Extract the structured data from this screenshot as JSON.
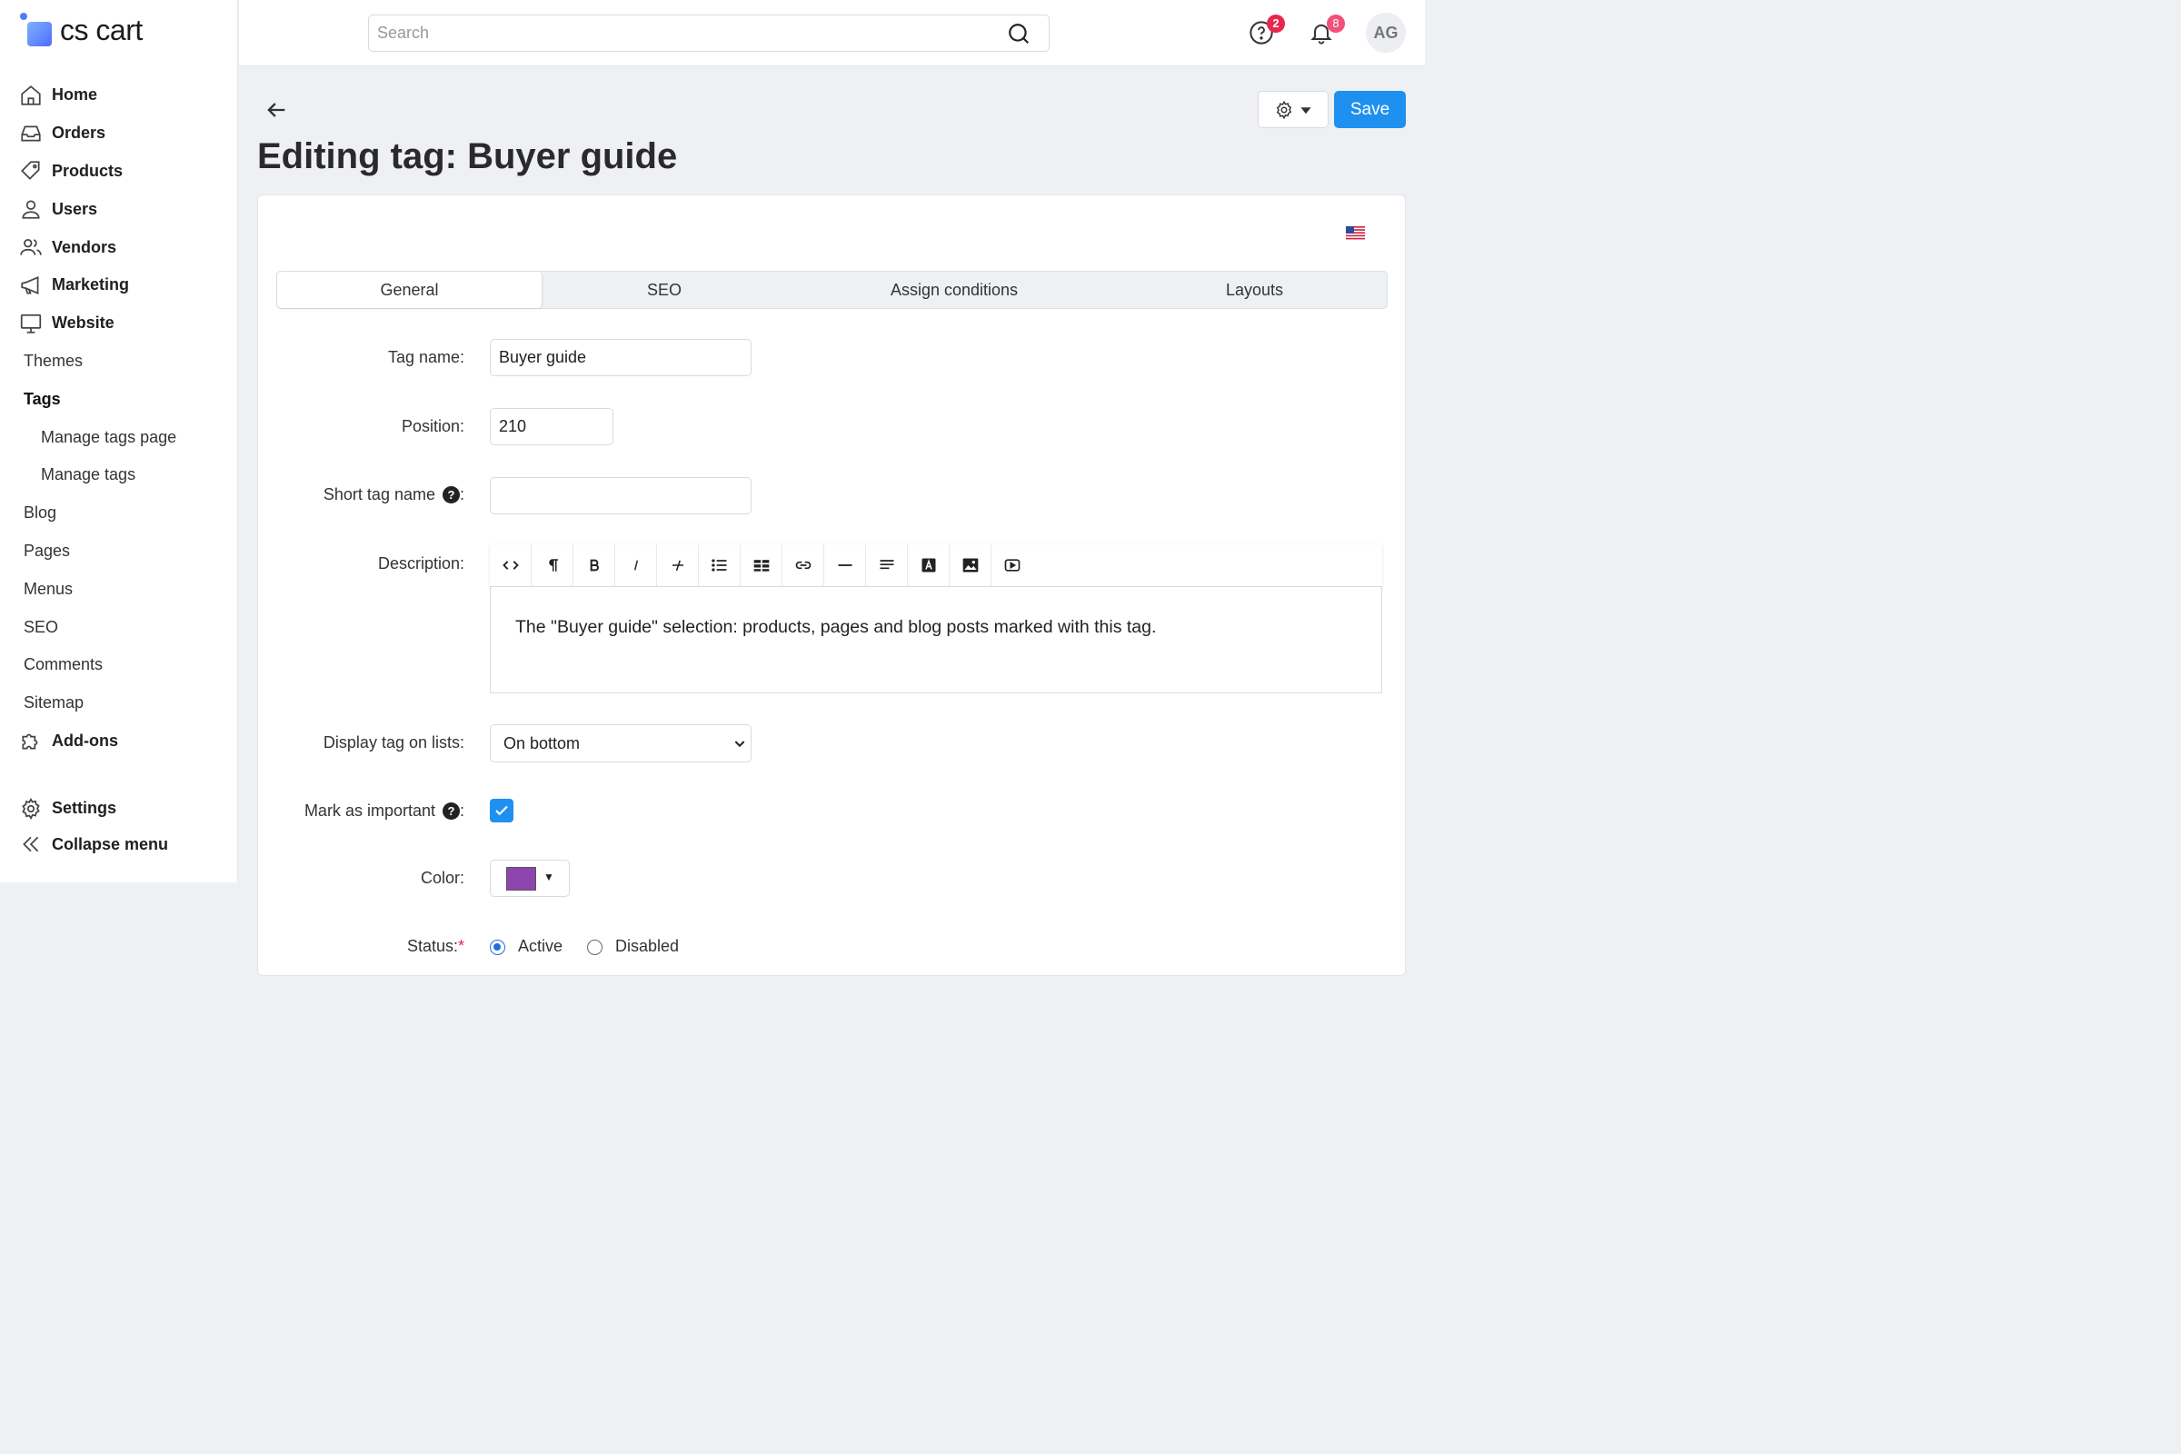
{
  "brand": {
    "name": "cs cart"
  },
  "nav": {
    "home": "Home",
    "orders": "Orders",
    "products": "Products",
    "users": "Users",
    "vendors": "Vendors",
    "marketing": "Marketing",
    "website": "Website",
    "themes": "Themes",
    "tags": "Tags",
    "manage_tags_page": "Manage tags page",
    "manage_tags": "Manage tags",
    "blog": "Blog",
    "pages": "Pages",
    "menus": "Menus",
    "seo": "SEO",
    "comments": "Comments",
    "sitemap": "Sitemap",
    "addons": "Add-ons",
    "settings": "Settings",
    "collapse": "Collapse menu"
  },
  "header": {
    "search_placeholder": "Search",
    "help_badge": "2",
    "notifications_badge": "8",
    "avatar_initials": "AG"
  },
  "toolbar": {
    "save_label": "Save"
  },
  "page": {
    "title": "Editing tag: Buyer guide"
  },
  "tabs": [
    "General",
    "SEO",
    "Assign conditions",
    "Layouts"
  ],
  "form": {
    "tag_name_label": "Tag name:",
    "tag_name_value": "Buyer guide",
    "position_label": "Position:",
    "position_value": "210",
    "short_tag_name_label": "Short tag name",
    "short_tag_name_value": "",
    "description_label": "Description:",
    "description_text": "The \"Buyer guide\" selection: products, pages and blog posts marked with this tag.",
    "display_label": "Display tag on lists:",
    "display_value": "On bottom",
    "important_label": "Mark as important",
    "color_label": "Color:",
    "color_value": "#8e44ad",
    "status_label": "Status:",
    "status_active": "Active",
    "status_disabled": "Disabled",
    "help_glyph": "?",
    "colon": ":",
    "required_mark": "*"
  },
  "colors": {
    "accent": "#1e90f0",
    "badge": "#e5284d"
  }
}
